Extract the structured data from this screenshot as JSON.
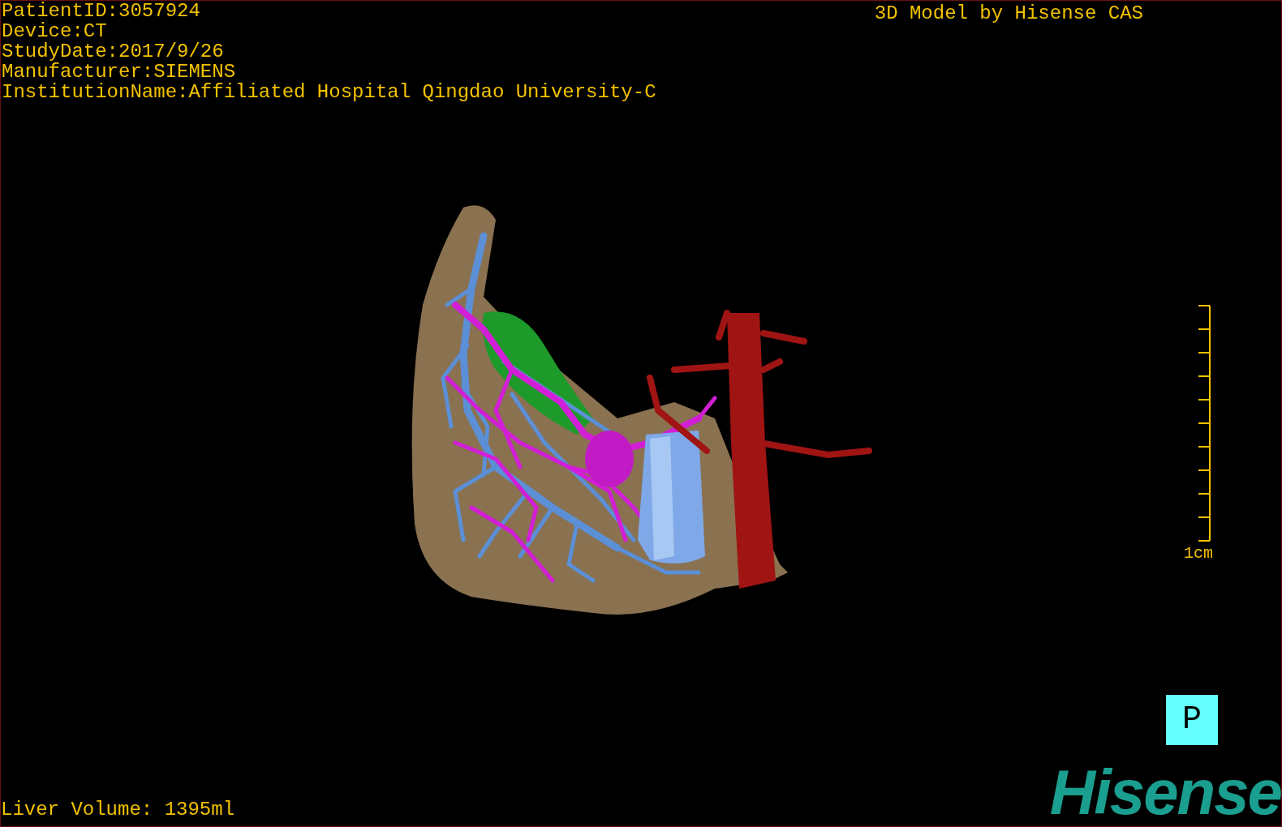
{
  "patient_info": [
    "PatientID:3057924",
    "Device:CT",
    "StudyDate:2017/9/26",
    "Manufacturer:SIEMENS",
    "InstitutionName:Affiliated Hospital Qingdao University-C"
  ],
  "header_title": "3D Model by Hisense CAS",
  "scale_bar": {
    "label": "1cm"
  },
  "orientation_marker": "P",
  "liver_volume": "Liver Volume: 1395ml",
  "logo": "Hisense"
}
